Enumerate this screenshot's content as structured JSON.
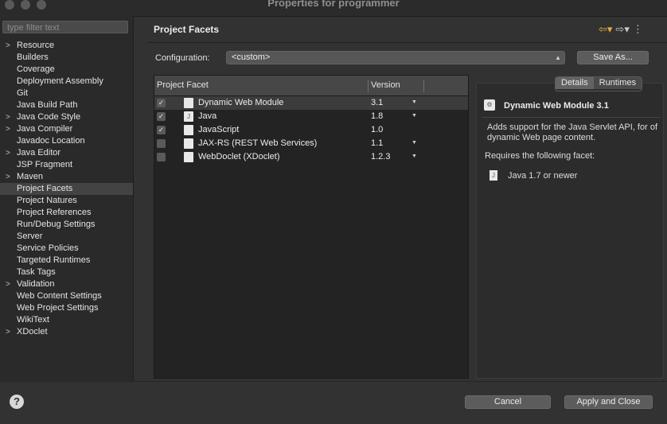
{
  "window": {
    "title": "Properties for programmer"
  },
  "filter": {
    "placeholder": "type filter text"
  },
  "tree": [
    {
      "label": "Resource",
      "expandable": true
    },
    {
      "label": "Builders",
      "expandable": false
    },
    {
      "label": "Coverage",
      "expandable": false
    },
    {
      "label": "Deployment Assembly",
      "expandable": false
    },
    {
      "label": "Git",
      "expandable": false
    },
    {
      "label": "Java Build Path",
      "expandable": false
    },
    {
      "label": "Java Code Style",
      "expandable": true
    },
    {
      "label": "Java Compiler",
      "expandable": true
    },
    {
      "label": "Javadoc Location",
      "expandable": false
    },
    {
      "label": "Java Editor",
      "expandable": true
    },
    {
      "label": "JSP Fragment",
      "expandable": false
    },
    {
      "label": "Maven",
      "expandable": true
    },
    {
      "label": "Project Facets",
      "expandable": false,
      "selected": true
    },
    {
      "label": "Project Natures",
      "expandable": false
    },
    {
      "label": "Project References",
      "expandable": false
    },
    {
      "label": "Run/Debug Settings",
      "expandable": false
    },
    {
      "label": "Server",
      "expandable": false
    },
    {
      "label": "Service Policies",
      "expandable": false
    },
    {
      "label": "Targeted Runtimes",
      "expandable": false
    },
    {
      "label": "Task Tags",
      "expandable": false
    },
    {
      "label": "Validation",
      "expandable": true
    },
    {
      "label": "Web Content Settings",
      "expandable": false
    },
    {
      "label": "Web Project Settings",
      "expandable": false
    },
    {
      "label": "WikiText",
      "expandable": false
    },
    {
      "label": "XDoclet",
      "expandable": true
    }
  ],
  "page": {
    "title": "Project Facets"
  },
  "config": {
    "label": "Configuration:",
    "value": "<custom>",
    "save_as": "Save As..."
  },
  "table": {
    "col_facet": "Project Facet",
    "col_version": "Version",
    "rows": [
      {
        "name": "Dynamic Web Module",
        "version": "3.1",
        "checked": true,
        "has_dropdown": true,
        "selected": true
      },
      {
        "name": "Java",
        "version": "1.8",
        "checked": true,
        "has_dropdown": true
      },
      {
        "name": "JavaScript",
        "version": "1.0",
        "checked": true,
        "has_dropdown": false
      },
      {
        "name": "JAX-RS (REST Web Services)",
        "version": "1.1",
        "checked": false,
        "has_dropdown": true
      },
      {
        "name": "WebDoclet (XDoclet)",
        "version": "1.2.3",
        "checked": false,
        "has_dropdown": true
      }
    ]
  },
  "details": {
    "tab_details": "Details",
    "tab_runtimes": "Runtimes",
    "title": "Dynamic Web Module 3.1",
    "description": "Adds support for the Java Servlet API, for of dynamic Web page content.",
    "requires_label": "Requires the following facet:",
    "requirement": "Java 1.7 or newer"
  },
  "buttons": {
    "cancel": "Cancel",
    "apply_close": "Apply and Close"
  }
}
